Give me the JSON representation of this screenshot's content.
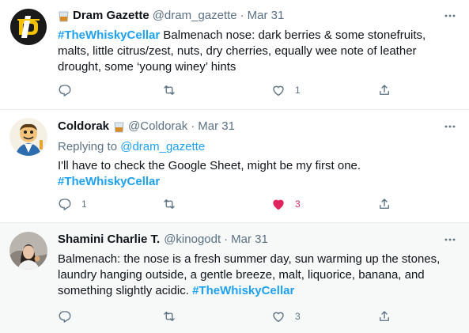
{
  "tweets": [
    {
      "name": "Dram Gazette",
      "handle": "@dram_gazette",
      "separator": "·",
      "date": "Mar 31",
      "text_hashtag": "#TheWhiskyCellar",
      "text_body": " Balmenach nose: dark berries & some stonefruits, malts, little citrus/zest, nuts, dry cherries, equally wee note of leather drought, some ‘young winey’ hints",
      "reply_count": "",
      "retweet_count": "",
      "like_count": "1",
      "liked": false
    },
    {
      "name": "Coldorak",
      "handle": "@Coldorak",
      "separator": "·",
      "date": "Mar 31",
      "replying_prefix": "Replying to ",
      "replying_to": "@dram_gazette",
      "text_body": "I'll have to check the Google Sheet, might be my first one.",
      "text_hashtag": "#TheWhiskyCellar",
      "reply_count": "1",
      "retweet_count": "",
      "like_count": "3",
      "liked": true
    },
    {
      "name": "Shamini Charlie T.",
      "handle": "@kinogodt",
      "separator": "·",
      "date": "Mar 31",
      "text_body": "Balmenach: the nose is a fresh summer day, sun warming up the stones, laundry hanging outside, a gentle breeze, malt, liquorice, banana, and something slightly acidic. ",
      "text_hashtag": "#TheWhiskyCellar",
      "reply_count": "",
      "retweet_count": "",
      "like_count": "3",
      "liked": false
    }
  ],
  "icons": {
    "reply": "reply-icon",
    "retweet": "retweet-icon",
    "like": "heart-icon",
    "share": "share-icon",
    "more": "more-icon",
    "emoji": "whisky-glass-emoji"
  },
  "colors": {
    "link": "#1da1f2",
    "muted": "#5b7083",
    "like": "#e0245e",
    "border": "#e6ecf0",
    "hover_bg": "#f7f9f9"
  }
}
